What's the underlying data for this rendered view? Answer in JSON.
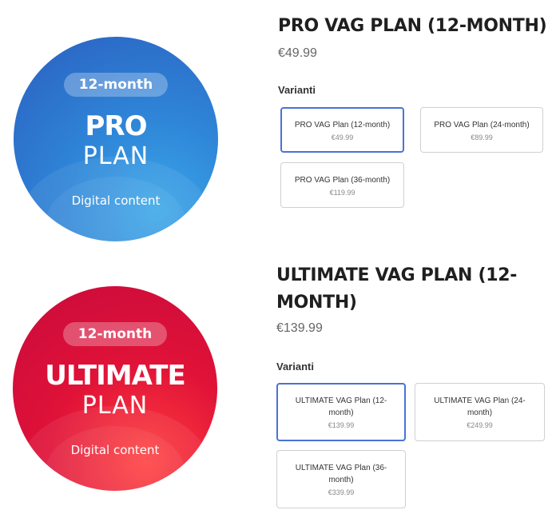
{
  "products": [
    {
      "image": {
        "pill": "12-month",
        "plan_name": "PRO",
        "plan_word": "PLAN",
        "caption": "Digital content"
      },
      "title": "PRO VAG PLAN (12-MONTH)",
      "price": "€49.99",
      "variants_label": "Varianti",
      "variants": [
        {
          "name": "PRO VAG Plan (12-month)",
          "price": "€49.99",
          "selected": true
        },
        {
          "name": "PRO VAG Plan (24-month)",
          "price": "€89.99",
          "selected": false
        },
        {
          "name": "PRO VAG Plan (36-month)",
          "price": "€119.99",
          "selected": false
        }
      ]
    },
    {
      "image": {
        "pill": "12-month",
        "plan_name": "ULTIMATE",
        "plan_word": "PLAN",
        "caption": "Digital content"
      },
      "title_line1": "ULTIMATE VAG PLAN (12-",
      "title_line2": "MONTH)",
      "price": "€139.99",
      "variants_label": "Varianti",
      "variants": [
        {
          "name": "ULTIMATE VAG Plan (12-month)",
          "price": "€139.99",
          "selected": true
        },
        {
          "name": "ULTIMATE VAG Plan (24-month)",
          "price": "€249.99",
          "selected": false
        },
        {
          "name": "ULTIMATE VAG Plan (36-month)",
          "price": "€339.99",
          "selected": false
        }
      ]
    }
  ]
}
